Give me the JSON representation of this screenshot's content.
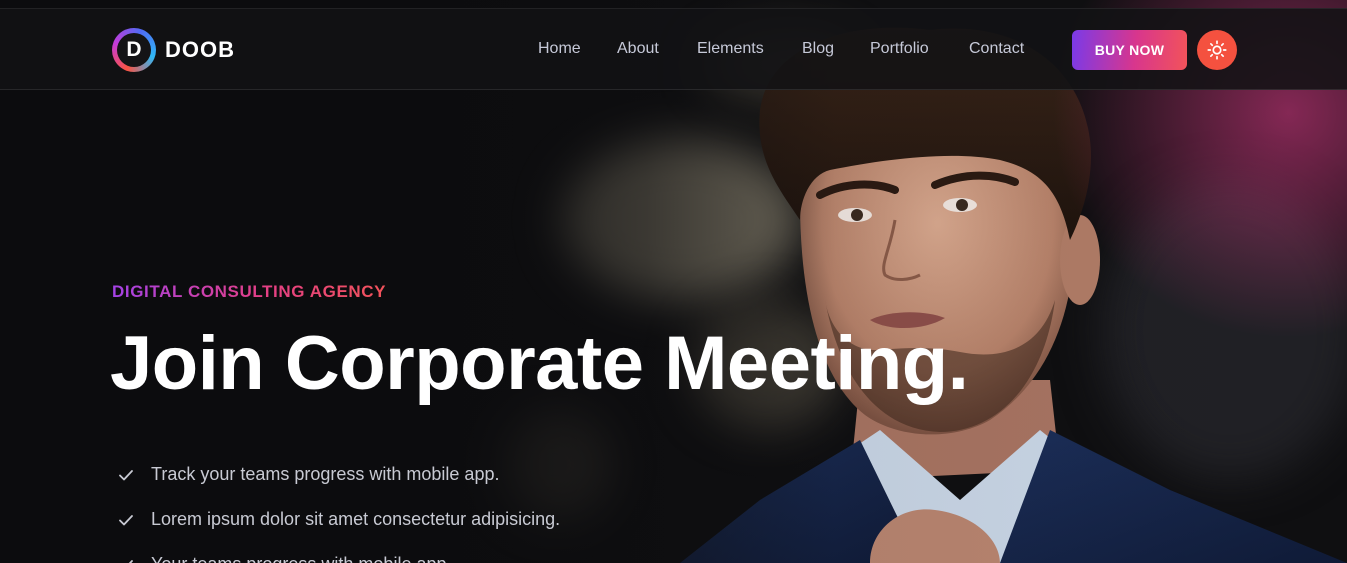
{
  "brand": {
    "logo_letter": "D",
    "name": "DOOB"
  },
  "nav": {
    "items": [
      {
        "label": "Home"
      },
      {
        "label": "About"
      },
      {
        "label": "Elements"
      },
      {
        "label": "Blog"
      },
      {
        "label": "Portfolio"
      },
      {
        "label": "Contact"
      }
    ],
    "cta_label": "BUY NOW",
    "theme_toggle_icon": "sun-icon"
  },
  "hero": {
    "subtitle": "DIGITAL CONSULTING AGENCY",
    "title": "Join Corporate Meeting.",
    "features": [
      {
        "text": "Track your teams progress with mobile app.",
        "icon": "check-icon"
      },
      {
        "text": "Lorem ipsum dolor sit amet consectetur adipisicing.",
        "icon": "check-icon"
      },
      {
        "text": "Your teams progress with mobile app.",
        "icon": "check-icon"
      }
    ]
  },
  "colors": {
    "accent_start": "#7a3ae8",
    "accent_mid": "#d8368d",
    "accent_end": "#f2535a",
    "theme_button": "#f4513f",
    "background": "#0f0f11"
  }
}
